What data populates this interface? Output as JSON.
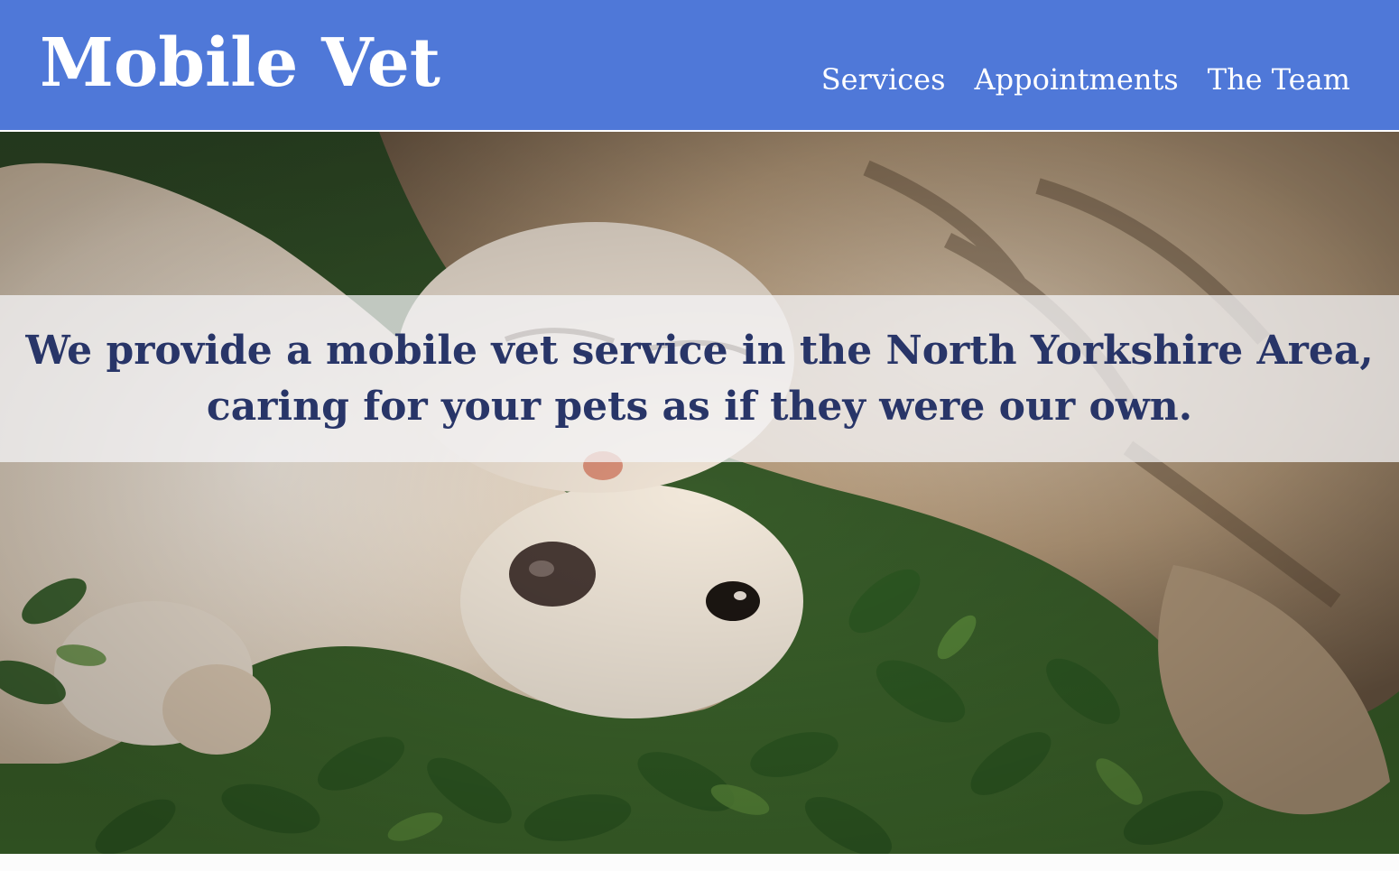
{
  "site": {
    "title": "Mobile Vet"
  },
  "nav": {
    "items": [
      "Services",
      "Appointments",
      "The Team"
    ]
  },
  "hero": {
    "line1": "We provide a mobile vet service in the North Yorkshire Area,",
    "line2": "caring for your pets as if they were our own.",
    "image_subject": "dog and cat lying on grass"
  },
  "colors": {
    "header_bg": "#4f78d8",
    "header_text": "#ffffff",
    "banner_text": "#283568"
  }
}
